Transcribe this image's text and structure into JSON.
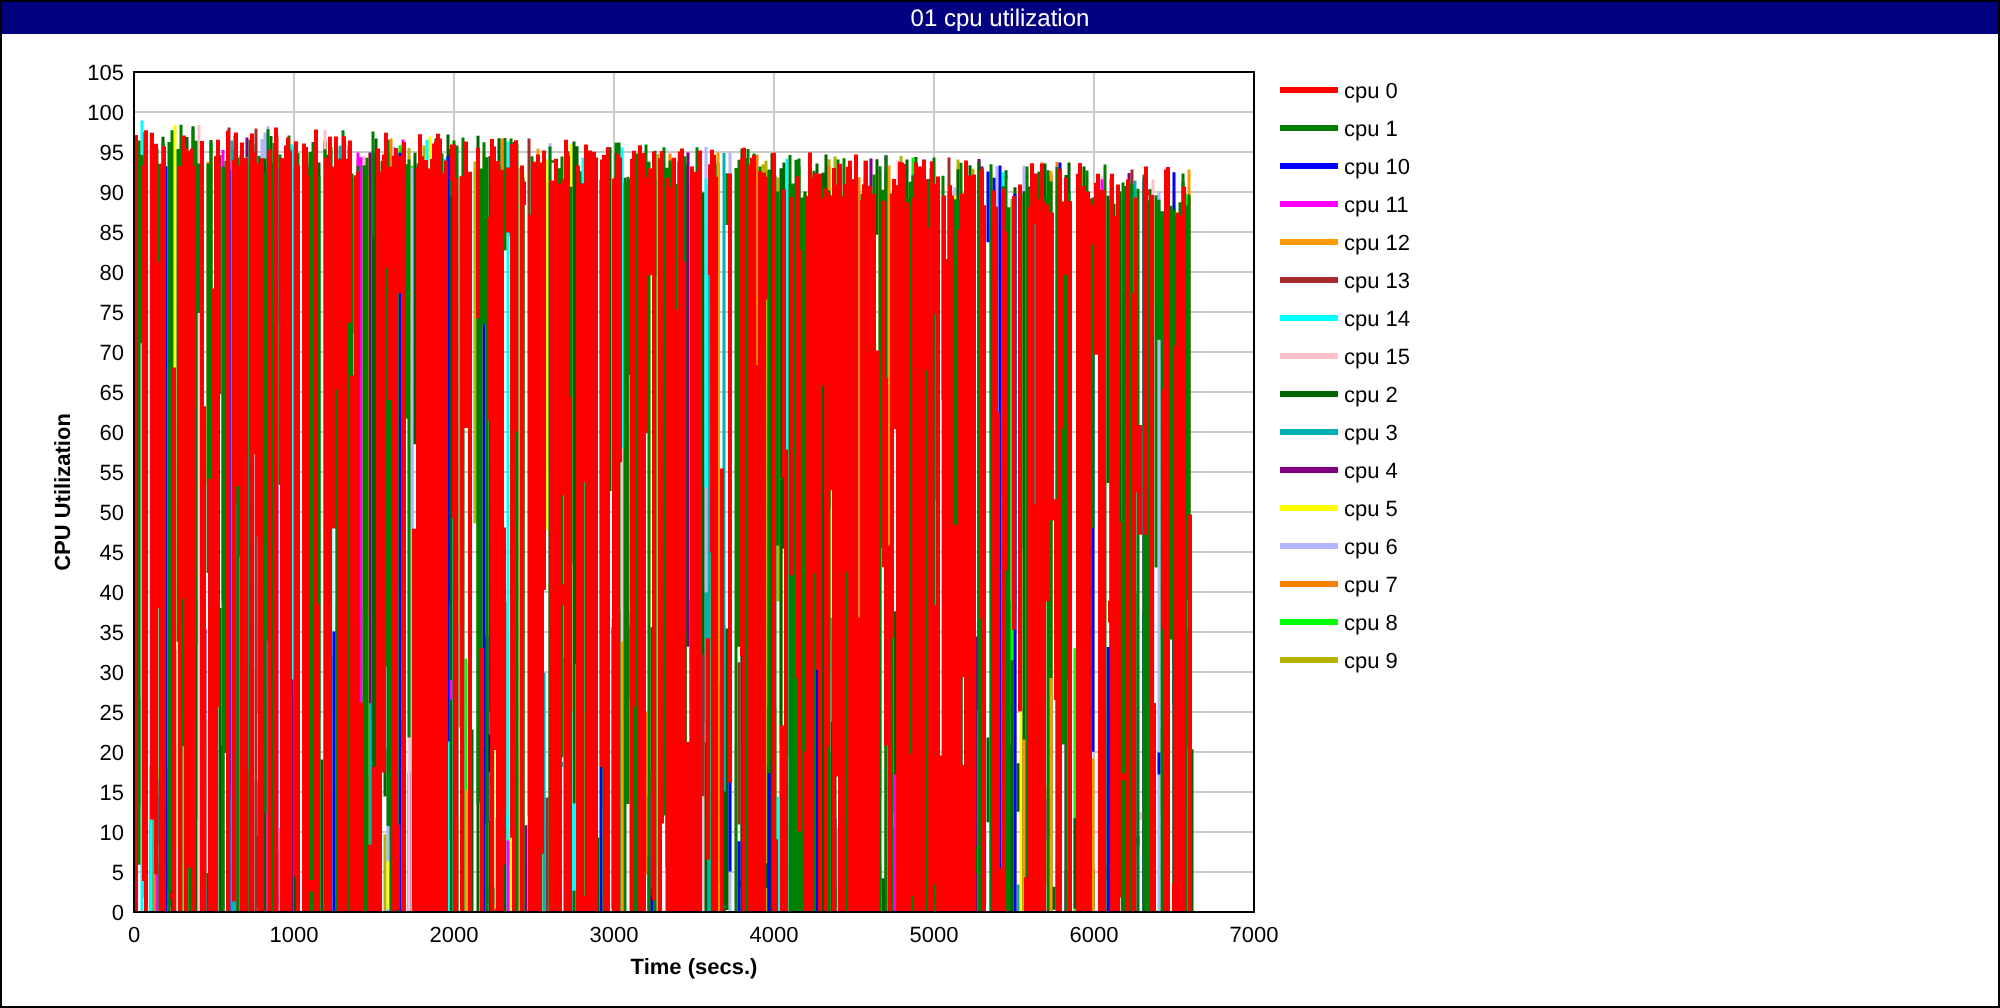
{
  "window": {
    "title": "01 cpu utilization"
  },
  "chart": {
    "ylabel": "CPU Utilization",
    "xlabel": "Time (secs.)",
    "yticks": [
      "105",
      "100",
      "95",
      "90",
      "85",
      "80",
      "75",
      "70",
      "65",
      "60",
      "55",
      "50",
      "45",
      "40",
      "35",
      "30",
      "25",
      "20",
      "15",
      "10",
      "5",
      "0"
    ],
    "xticks": [
      "0",
      "1000",
      "2000",
      "3000",
      "4000",
      "5000",
      "6000",
      "7000"
    ],
    "legend": [
      {
        "label": "cpu 0",
        "color": "#ff0000"
      },
      {
        "label": "cpu 1",
        "color": "#008000"
      },
      {
        "label": "cpu 10",
        "color": "#0000ff"
      },
      {
        "label": "cpu 11",
        "color": "#ff00ff"
      },
      {
        "label": "cpu 12",
        "color": "#ff9900"
      },
      {
        "label": "cpu 13",
        "color": "#a52a2a"
      },
      {
        "label": "cpu 14",
        "color": "#00ffff"
      },
      {
        "label": "cpu 15",
        "color": "#ffc0cb"
      },
      {
        "label": "cpu 2",
        "color": "#006400"
      },
      {
        "label": "cpu 3",
        "color": "#00b2b2"
      },
      {
        "label": "cpu 4",
        "color": "#800080"
      },
      {
        "label": "cpu 5",
        "color": "#ffff00"
      },
      {
        "label": "cpu 6",
        "color": "#b4b4ff"
      },
      {
        "label": "cpu 7",
        "color": "#ff8000"
      },
      {
        "label": "cpu 8",
        "color": "#00ff00"
      },
      {
        "label": "cpu 9",
        "color": "#b4b400"
      }
    ]
  }
}
